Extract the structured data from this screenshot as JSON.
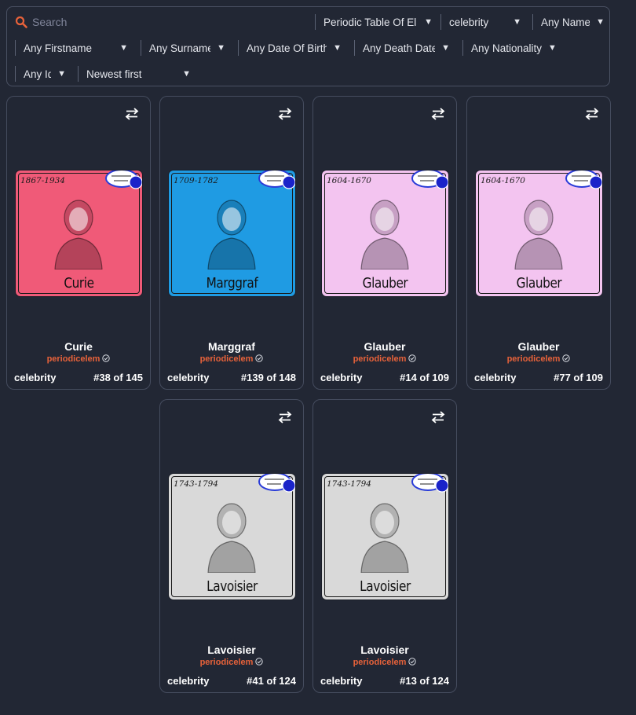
{
  "filters": {
    "search_placeholder": "Search",
    "collection": "Periodic Table Of El",
    "schema": "celebrity",
    "name": "Any Name",
    "firstname": "Any Firstname",
    "surname": "Any Surname",
    "date_of_birth": "Any Date Of Birth",
    "death_date": "Any Death Date",
    "nationality": "Any Nationality",
    "id": "Any Id",
    "sort": "Newest first"
  },
  "colors": {
    "accent": "#e8623a",
    "background": "#222734",
    "card_border": "#454c5e"
  },
  "cards": [
    {
      "art_years": "1867-1934",
      "art_caption": "Curie",
      "art_bg": "#f05a78",
      "title": "Curie",
      "creator": "periodicelem",
      "category": "celebrity",
      "edition": "#38 of 145"
    },
    {
      "art_years": "1709-1782",
      "art_caption": "Marggraf",
      "art_bg": "#1f9be3",
      "title": "Marggraf",
      "creator": "periodicelem",
      "category": "celebrity",
      "edition": "#139 of 148"
    },
    {
      "art_years": "1604-1670",
      "art_caption": "Glauber",
      "art_bg": "#f3c4f0",
      "title": "Glauber",
      "creator": "periodicelem",
      "category": "celebrity",
      "edition": "#14 of 109"
    },
    {
      "art_years": "1604-1670",
      "art_caption": "Glauber",
      "art_bg": "#f3c4f0",
      "title": "Glauber",
      "creator": "periodicelem",
      "category": "celebrity",
      "edition": "#77 of 109"
    },
    {
      "art_years": "1743-1794",
      "art_caption": "Lavoisier",
      "art_bg": "#d9d9d9",
      "title": "Lavoisier",
      "creator": "periodicelem",
      "category": "celebrity",
      "edition": "#41 of 124"
    },
    {
      "art_years": "1743-1794",
      "art_caption": "Lavoisier",
      "art_bg": "#d9d9d9",
      "title": "Lavoisier",
      "creator": "periodicelem",
      "category": "celebrity",
      "edition": "#13 of 124"
    }
  ]
}
